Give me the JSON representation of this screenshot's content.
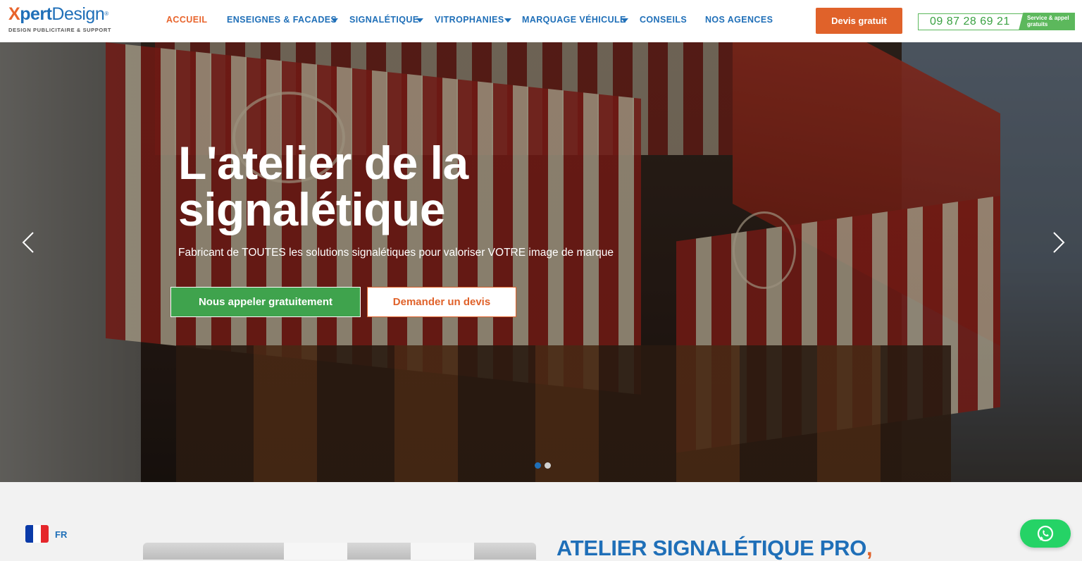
{
  "brand": {
    "logo_x": "X",
    "logo_pert": "pert",
    "logo_design": "Design",
    "logo_reg": "®",
    "tagline": "DESIGN PUBLICITAIRE & SUPPORT"
  },
  "nav": {
    "items": [
      {
        "label": "ACCUEIL",
        "active": true,
        "dropdown": false
      },
      {
        "label": "ENSEIGNES & FACADES",
        "active": false,
        "dropdown": true
      },
      {
        "label": "SIGNALÉTIQUE",
        "active": false,
        "dropdown": true
      },
      {
        "label": "VITROPHANIES",
        "active": false,
        "dropdown": true
      },
      {
        "label": "MARQUAGE VÉHICULE",
        "active": false,
        "dropdown": true
      },
      {
        "label": "CONSEILS",
        "active": false,
        "dropdown": false
      },
      {
        "label": "NOS AGENCES",
        "active": false,
        "dropdown": false
      }
    ]
  },
  "header": {
    "quote_button": "Devis gratuit",
    "phone": "09 87 28 69 21",
    "phone_tag": "Service & appel gratuits"
  },
  "hero": {
    "title": "L'atelier de la signalétique",
    "subtitle": "Fabricant de TOUTES les solutions signalétiques pour valoriser VOTRE image de marque",
    "call_button": "Nous appeler gratuitement",
    "devis_button": "Demander un devis",
    "slide_count": 2,
    "active_slide": 1
  },
  "language": {
    "label": "FR"
  },
  "section": {
    "title": "ATELIER SIGNALÉTIQUE PRO",
    "title_accent": ","
  },
  "colors": {
    "brand_blue": "#1f6fb8",
    "brand_orange": "#e0622a",
    "green": "#3fa34d",
    "whatsapp": "#25d366"
  },
  "icons": {
    "nav_dropdown": "chevron-down-icon",
    "slider_prev": "chevron-left-icon",
    "slider_next": "chevron-right-icon",
    "language": "france-flag-icon",
    "chat": "whatsapp-icon"
  }
}
